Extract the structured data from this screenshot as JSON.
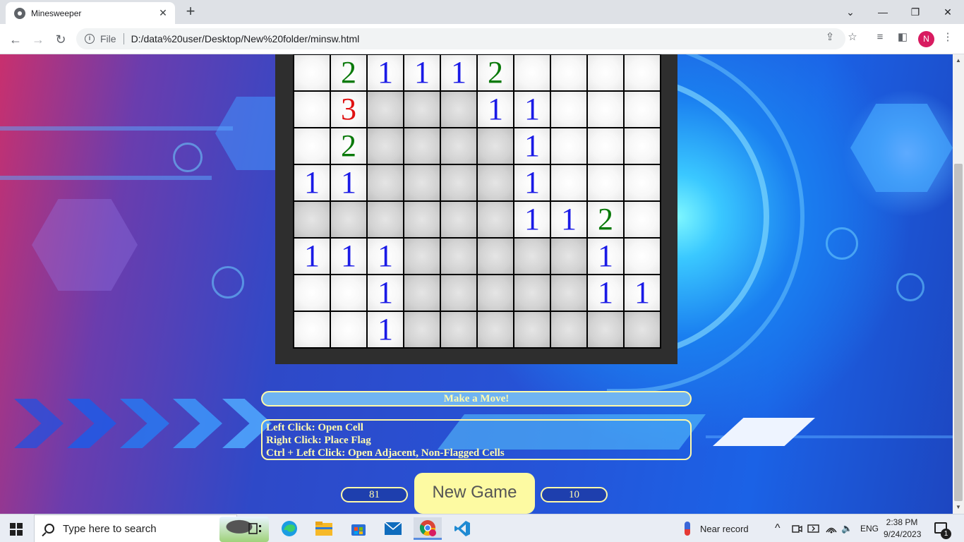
{
  "browser": {
    "tab_title": "Minesweeper",
    "tab_close": "✕",
    "new_tab": "+",
    "file_label": "File",
    "url": "D:/data%20user/Desktop/New%20folder/minsw.html",
    "profile_initial": "N",
    "window_controls": {
      "tab_search": "⌄",
      "minimize": "—",
      "restore": "❐",
      "close": "✕"
    },
    "nav": {
      "back": "←",
      "forward": "→",
      "reload": "↻"
    },
    "omnibox_icons": {
      "share": "⇪",
      "bookmark": "☆",
      "reading_list": "≡",
      "side_panel": "◧",
      "menu": "⋮"
    }
  },
  "game": {
    "board": [
      [
        "",
        "2",
        "1",
        "1",
        "1",
        "2",
        "",
        "",
        "",
        ""
      ],
      [
        "",
        "3",
        "#",
        "#",
        "#",
        "1",
        "1",
        "",
        "",
        ""
      ],
      [
        "",
        "2",
        "#",
        "#",
        "#",
        "#",
        "1",
        "",
        "",
        ""
      ],
      [
        "1",
        "1",
        "#",
        "#",
        "#",
        "#",
        "1",
        "",
        "",
        ""
      ],
      [
        "#",
        "#",
        "#",
        "#",
        "#",
        "#",
        "1",
        "1",
        "2",
        ""
      ],
      [
        "1",
        "1",
        "1",
        "#",
        "#",
        "#",
        "#",
        "#",
        "1",
        ""
      ],
      [
        "",
        "",
        "1",
        "#",
        "#",
        "#",
        "#",
        "#",
        "1",
        "1"
      ],
      [
        "",
        "",
        "1",
        "#",
        "#",
        "#",
        "#",
        "#",
        "#",
        "#"
      ]
    ],
    "board_legend": {
      "closed_cell": "#",
      "empty_open_cell": ""
    },
    "status": "Make a Move!",
    "help": {
      "left_click": "Left Click: Open Cell",
      "right_click": "Right Click: Place Flag",
      "ctrl_click": "Ctrl + Left Click: Open Adjacent, Non-Flagged Cells"
    },
    "cells_counter": "81",
    "mines_counter": "10",
    "new_game_label": "New Game",
    "number_colors": {
      "1": "#1a1ae6",
      "2": "#0b7a0b",
      "3": "#e01111"
    }
  },
  "taskbar": {
    "search_placeholder": "Type here to search",
    "weather": "Near record",
    "language": "ENG",
    "time": "2:38 PM",
    "date": "9/24/2023",
    "notification_count": "1",
    "tray_icons": {
      "overflow": "^",
      "volume": "🔈"
    }
  }
}
